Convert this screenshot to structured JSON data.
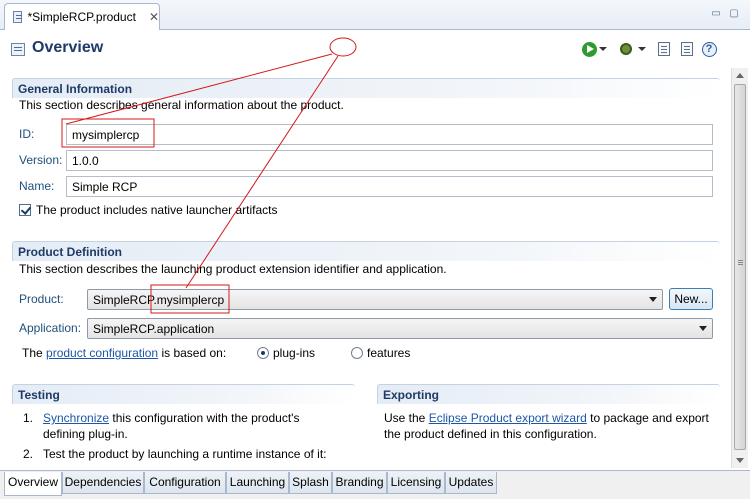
{
  "editor_tab": {
    "title": "*SimpleRCP.product",
    "close": "✕"
  },
  "window": {
    "minimize": "▭",
    "maximize": "▢"
  },
  "header": {
    "title": "Overview",
    "help": "?"
  },
  "general": {
    "title": "General Information",
    "description": "This section describes general information about the product.",
    "id_label": "ID:",
    "id_value": "mysimplercp",
    "version_label": "Version:",
    "version_value": "1.0.0",
    "name_label": "Name:",
    "name_value": "Simple RCP",
    "launcher_checkbox_label": "The product includes native launcher artifacts",
    "launcher_checked": true
  },
  "definition": {
    "title": "Product Definition",
    "description": "This section describes the launching product extension identifier and application.",
    "product_label": "Product:",
    "product_value": "SimpleRCP.mysimplercp",
    "new_button": "New...",
    "application_label": "Application:",
    "application_value": "SimpleRCP.application",
    "config_prefix": "The",
    "config_link": "product configuration",
    "config_suffix": "is based on:",
    "option_plugins": "plug-ins",
    "option_features": "features",
    "selected_option": "plug-ins"
  },
  "testing": {
    "title": "Testing",
    "items": [
      {
        "num": "1.",
        "link": "Synchronize",
        "text1": "this configuration with the product's",
        "text2": "defining plug-in."
      },
      {
        "num": "2.",
        "text1": "Test the product by launching a runtime instance of it:"
      }
    ]
  },
  "exporting": {
    "title": "Exporting",
    "prefix": "Use the",
    "link": "Eclipse Product export wizard",
    "suffix": "to package and export",
    "line2": "the product defined in this configuration."
  },
  "page_tabs": [
    "Overview",
    "Dependencies",
    "Configuration",
    "Launching",
    "Splash",
    "Branding",
    "Licensing",
    "Updates"
  ],
  "active_page_tab": "Overview",
  "colors": {
    "annotation": "#d41a1a",
    "title": "#1e3a66",
    "link": "#1d56a8",
    "label": "#1f4f7a"
  }
}
